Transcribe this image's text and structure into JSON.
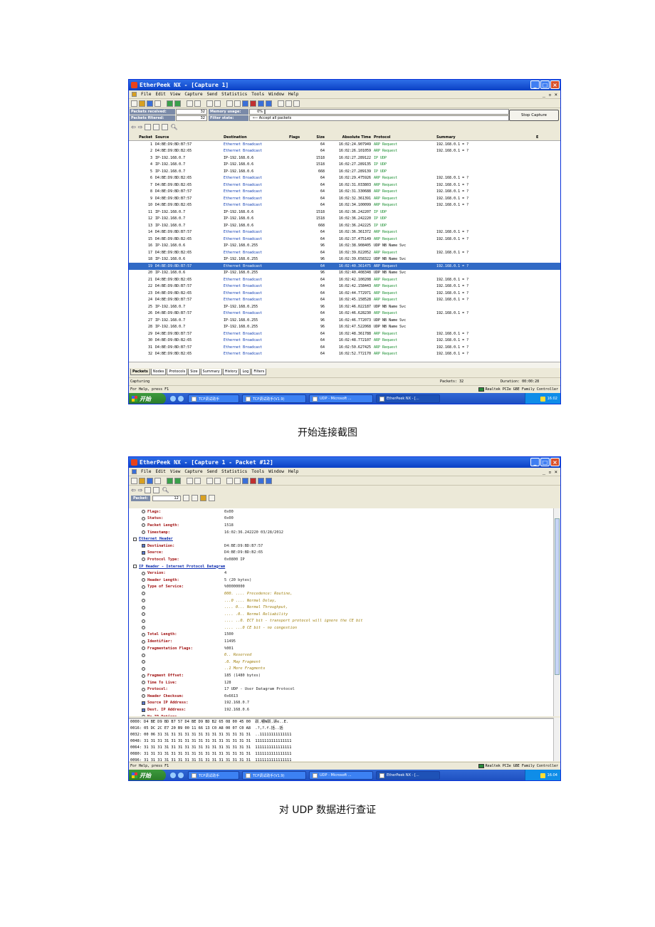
{
  "shot1": {
    "title": "EtherPeek NX - [Capture 1]",
    "menu": [
      "File",
      "Edit",
      "View",
      "Capture",
      "Send",
      "Statistics",
      "Tools",
      "Window",
      "Help"
    ],
    "mdi_controls": "_ ▫ ×",
    "packets_received_label": "Packets received:",
    "packets_received": "32",
    "packets_filtered_label": "Packets filtered:",
    "packets_filtered": "32",
    "memory_usage_label": "Memory usage:",
    "memory_usage": "0%",
    "filter_state_label": "Filter state:",
    "filter_state": "Accept all packets",
    "stop_capture": "Stop Capture",
    "columns": [
      "Packet",
      "Source",
      "Destination",
      "Flags",
      "Size",
      "Absolute Time",
      "Protocol",
      "Summary",
      "E"
    ],
    "rows": [
      [
        "1",
        "D4:BE:D9:BD:B7:57",
        "Ethernet Broadcast",
        "",
        "64",
        "16:02:24.907949",
        "ARP Request",
        "192.168.0.1 = ?"
      ],
      [
        "2",
        "D4:BE:D9:BD:B2:65",
        "Ethernet Broadcast",
        "",
        "64",
        "16:02:26.101059",
        "ARP Request",
        "192.168.0.1 = ?"
      ],
      [
        "3",
        "IP-192.168.0.7",
        "IP-192.168.0.6",
        "",
        "1518",
        "16:02:27.289122",
        "IP UDP",
        ""
      ],
      [
        "4",
        "IP-192.168.0.7",
        "IP-192.168.0.6",
        "",
        "1518",
        "16:02:27.289135",
        "IP UDP",
        ""
      ],
      [
        "5",
        "IP-192.168.0.7",
        "IP-192.168.0.6",
        "",
        "668",
        "16:02:27.289139",
        "IP UDP",
        ""
      ],
      [
        "6",
        "D4:BE:D9:BD:B2:65",
        "Ethernet Broadcast",
        "",
        "64",
        "16:02:29.475926",
        "ARP Request",
        "192.168.0.1 = ?"
      ],
      [
        "7",
        "D4:BE:D9:BD:B2:65",
        "Ethernet Broadcast",
        "",
        "64",
        "16:02:31.033803",
        "ARP Request",
        "192.168.0.1 = ?"
      ],
      [
        "8",
        "D4:BE:D9:BD:B7:57",
        "Ethernet Broadcast",
        "",
        "64",
        "16:02:31.330688",
        "ARP Request",
        "192.168.0.1 = ?"
      ],
      [
        "9",
        "D4:BE:D9:BD:B7:57",
        "Ethernet Broadcast",
        "",
        "64",
        "16:02:32.361391",
        "ARP Request",
        "192.168.0.1 = ?"
      ],
      [
        "10",
        "D4:BE:D9:BD:B2:65",
        "Ethernet Broadcast",
        "",
        "64",
        "16:02:34.100099",
        "ARP Request",
        "192.168.0.1 = ?"
      ],
      [
        "11",
        "IP-192.168.0.7",
        "IP-192.168.0.6",
        "",
        "1518",
        "16:02:36.242207",
        "IP UDP",
        ""
      ],
      [
        "12",
        "IP-192.168.0.7",
        "IP-192.168.0.6",
        "",
        "1518",
        "16:02:36.242220",
        "IP UDP",
        ""
      ],
      [
        "13",
        "IP-192.168.0.7",
        "IP-192.168.0.6",
        "",
        "668",
        "16:02:36.242225",
        "IP UDP",
        ""
      ],
      [
        "14",
        "D4:BE:D9:BD:B7:57",
        "Ethernet Broadcast",
        "",
        "64",
        "16:02:36.361372",
        "ARP Request",
        "192.168.0.1 = ?"
      ],
      [
        "15",
        "D4:BE:D9:BD:B2:65",
        "Ethernet Broadcast",
        "",
        "64",
        "16:02:37.475149",
        "ARP Request",
        "192.168.0.1 = ?"
      ],
      [
        "16",
        "IP-192.168.0.6",
        "IP-192.168.0.255",
        "",
        "96",
        "16:02:38.908405",
        "UDP NB Name Svc",
        ""
      ],
      [
        "17",
        "D4:BE:D9:BD:B2:65",
        "Ethernet Broadcast",
        "",
        "64",
        "16:02:39.022052",
        "ARP Request",
        "192.168.0.1 = ?"
      ],
      [
        "18",
        "IP-192.168.0.6",
        "IP-192.168.0.255",
        "",
        "96",
        "16:02:39.658322",
        "UDP NB Name Svc",
        ""
      ],
      [
        "19",
        "D4:BE:D9:BD:B7:57",
        "Ethernet Broadcast",
        "",
        "64",
        "16:02:40.361475",
        "ARP Request",
        "192.168.0.1 = ?"
      ],
      [
        "20",
        "IP-192.168.0.6",
        "IP-192.168.0.255",
        "",
        "96",
        "16:02:40.408348",
        "UDP NB Name Svc",
        ""
      ],
      [
        "21",
        "D4:BE:D9:BD:B2:65",
        "Ethernet Broadcast",
        "",
        "64",
        "16:02:42.100208",
        "ARP Request",
        "192.168.0.1 = ?"
      ],
      [
        "22",
        "D4:BE:D9:BD:B7:57",
        "Ethernet Broadcast",
        "",
        "64",
        "16:02:42.158443",
        "ARP Request",
        "192.168.0.1 = ?"
      ],
      [
        "23",
        "D4:BE:D9:BD:B2:65",
        "Ethernet Broadcast",
        "",
        "64",
        "16:02:44.772971",
        "ARP Request",
        "192.168.0.1 = ?"
      ],
      [
        "24",
        "D4:BE:D9:BD:B7:57",
        "Ethernet Broadcast",
        "",
        "64",
        "16:02:45.158528",
        "ARP Request",
        "192.168.0.1 = ?"
      ],
      [
        "25",
        "IP-192.168.0.7",
        "IP-192.168.0.255",
        "",
        "96",
        "16:02:46.022187",
        "UDP NB Name Svc",
        ""
      ],
      [
        "26",
        "D4:BE:D9:BD:B7:57",
        "Ethernet Broadcast",
        "",
        "64",
        "16:02:46.628230",
        "ARP Request",
        "192.168.0.1 = ?"
      ],
      [
        "27",
        "IP-192.168.0.7",
        "IP-192.168.0.255",
        "",
        "96",
        "16:02:46.772073",
        "UDP NB Name Svc",
        ""
      ],
      [
        "28",
        "IP-192.168.0.7",
        "IP-192.168.0.255",
        "",
        "96",
        "16:02:47.522068",
        "UDP NB Name Svc",
        ""
      ],
      [
        "29",
        "D4:BE:D9:BD:B7:57",
        "Ethernet Broadcast",
        "",
        "64",
        "16:02:48.361788",
        "ARP Request",
        "192.168.0.1 = ?"
      ],
      [
        "30",
        "D4:BE:D9:BD:B2:65",
        "Ethernet Broadcast",
        "",
        "64",
        "16:02:48.772107",
        "ARP Request",
        "192.168.0.1 = ?"
      ],
      [
        "31",
        "D4:BE:D9:BD:B7:57",
        "Ethernet Broadcast",
        "",
        "64",
        "16:02:50.627425",
        "ARP Request",
        "192.168.0.1 = ?"
      ],
      [
        "32",
        "D4:BE:D9:BD:B2:65",
        "Ethernet Broadcast",
        "",
        "64",
        "16:02:52.772170",
        "ARP Request",
        "192.168.0.1 = ?"
      ]
    ],
    "selected_row": "19",
    "tabs": [
      "Packets",
      "Nodes",
      "Protocols",
      "Size",
      "Summary",
      "History",
      "Log",
      "Filters"
    ],
    "status_left": "Capturing",
    "status_packets": "Packets: 32",
    "status_duration": "Duration: 00:00:28",
    "help_text": "For Help, press F1",
    "nic": "Realtek PCIe GBE Family Controller",
    "clock": "16:02"
  },
  "caption1": "开始连接截图",
  "shot2": {
    "title": "EtherPeek NX - [Capture 1 - Packet #12]",
    "packet_label": "Packet:",
    "packet_value": "12",
    "clock": "16:04",
    "tree": [
      {
        "k": "Flags:",
        "v": "0x00",
        "ind": 1,
        "ic": "dot"
      },
      {
        "k": "Status:",
        "v": "0x00",
        "ind": 1,
        "ic": "dot"
      },
      {
        "k": "Packet Length:",
        "v": "1518",
        "ind": 1,
        "ic": "dot"
      },
      {
        "k": "Timestamp:",
        "v": "16:02:36.242220 03/28/2012",
        "ind": 1,
        "ic": "dot"
      },
      {
        "h": "Ethernet Header",
        "ind": 0
      },
      {
        "k": "Destination:",
        "v": "D4:BE:D9:BD:B7:57",
        "ind": 1,
        "ic": "sq"
      },
      {
        "k": "Source:",
        "v": "D4:BE:D9:BD:B2:65",
        "ind": 1,
        "ic": "sq"
      },
      {
        "k": "Protocol Type:",
        "v": "0x0800  IP",
        "ind": 1,
        "ic": "dot"
      },
      {
        "h": "IP Header - Internet Protocol Datagram",
        "ind": 0
      },
      {
        "k": "Version:",
        "v": "4",
        "ind": 1,
        "ic": "dot"
      },
      {
        "k": "Header Length:",
        "v": "5  (20  bytes)",
        "ind": 1,
        "ic": "dot"
      },
      {
        "k": "Type of Service:",
        "v": "%00000000",
        "ind": 1,
        "ic": "dot"
      },
      {
        "k": "",
        "v": "000. .... Precedence: Routine,",
        "note": true,
        "ind": 1,
        "ic": "dot"
      },
      {
        "k": "",
        "v": "...0 .... Normal Delay,",
        "note": true,
        "ind": 1,
        "ic": "dot"
      },
      {
        "k": "",
        "v": ".... 0... Normal Throughput,",
        "note": true,
        "ind": 1,
        "ic": "dot"
      },
      {
        "k": "",
        "v": ".... .0.. Normal Reliability",
        "note": true,
        "ind": 1,
        "ic": "dot"
      },
      {
        "k": "",
        "v": ".... ..0. ECT bit - transport protocol will ignore the CE bit",
        "note": true,
        "ind": 1,
        "ic": "dot"
      },
      {
        "k": "",
        "v": ".... ...0 CE bit - no congestion",
        "note": true,
        "ind": 1,
        "ic": "dot"
      },
      {
        "k": "Total Length:",
        "v": "1500",
        "ind": 1,
        "ic": "dot"
      },
      {
        "k": "Identifier:",
        "v": "11495",
        "ind": 1,
        "ic": "dot"
      },
      {
        "k": "Fragmentation Flags:",
        "v": "%001",
        "ind": 1,
        "ic": "dot"
      },
      {
        "k": "",
        "v": "0.. Reserved",
        "note": true,
        "ind": 1,
        "ic": "dot"
      },
      {
        "k": "",
        "v": ".0. May Fragment",
        "note": true,
        "ind": 1,
        "ic": "dot"
      },
      {
        "k": "",
        "v": "..1 More Fragments",
        "note": true,
        "ind": 1,
        "ic": "dot"
      },
      {
        "k": "Fragment Offset:",
        "v": "185  (1480  bytes)",
        "ind": 1,
        "ic": "dot"
      },
      {
        "k": "Time To Live:",
        "v": "128",
        "ind": 1,
        "ic": "dot"
      },
      {
        "k": "Protocol:",
        "v": "17  UDP - User Datagram Protocol",
        "ind": 1,
        "ic": "dot"
      },
      {
        "k": "Header Checksum:",
        "v": "0x6613",
        "ind": 1,
        "ic": "dot"
      },
      {
        "k": "Source IP Address:",
        "v": "192.168.0.7",
        "ind": 1,
        "ic": "sq"
      },
      {
        "k": "Dest. IP Address:",
        "v": "192.168.0.6",
        "ind": 1,
        "ic": "sq"
      },
      {
        "k": "No IP Options",
        "v": "",
        "ind": 1,
        "ic": "dot"
      }
    ],
    "hex": [
      "0000: D4 BE D9 BD B7 57 D4 BE D9 BD B2 65 08 00 45 00  跃.嚼W跃.讲e..E.",
      "0016: 05 DC 2C E7 20 B9 00 11 66 13 C0 A8 00 07 C0 A8  .?,?.f.括..括",
      "0032: 00 06 31 31 31 31 31 31 31 31 31 31 31 31 31 31  ..11111111111111",
      "0048: 31 31 31 31 31 31 31 31 31 31 31 31 31 31 31 31  1111111111111111",
      "0064: 31 31 31 31 31 31 31 31 31 31 31 31 31 31 31 31  1111111111111111",
      "0080: 31 31 31 31 31 31 31 31 31 31 31 31 31 31 31 31  1111111111111111",
      "0096: 31 31 31 31 31 31 31 31 31 31 31 31 31 31 31 31  1111111111111111"
    ]
  },
  "caption2": "对 UDP 数据进行查证",
  "taskbar": {
    "start": "开始",
    "tasks": [
      "TCP调试助手",
      "TCP调试助手(V1.9)",
      "UDP - Microsoft ...",
      "EtherPeek NX - [..."
    ]
  }
}
